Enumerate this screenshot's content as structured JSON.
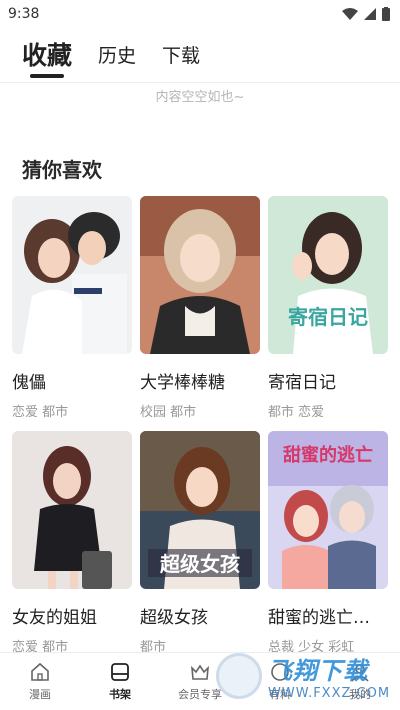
{
  "status": {
    "time": "9:38"
  },
  "tabs": [
    {
      "label": "收藏",
      "active": true
    },
    {
      "label": "历史",
      "active": false
    },
    {
      "label": "下载",
      "active": false
    }
  ],
  "empty_text": "内容空空如也~",
  "section_title": "猜你喜欢",
  "comics": [
    {
      "title": "傀儡",
      "tags": "恋爱 都市"
    },
    {
      "title": "大学棒棒糖",
      "tags": "校园 都市"
    },
    {
      "title": "寄宿日记",
      "tags": "都市 恋爱",
      "cover_text": "寄宿日记"
    },
    {
      "title": "女友的姐姐",
      "tags": "恋爱 都市"
    },
    {
      "title": "超级女孩",
      "tags": "都市",
      "cover_text": "超级女孩"
    },
    {
      "title": "甜蜜的逃亡…",
      "tags": "总裁 少女 彩虹",
      "cover_text": "甜蜜的逃亡"
    }
  ],
  "bottom_nav": [
    {
      "label": "漫画",
      "icon": "home-icon",
      "active": false
    },
    {
      "label": "书架",
      "icon": "bookshelf-icon",
      "active": true
    },
    {
      "label": "会员专享",
      "icon": "crown-icon",
      "active": false
    },
    {
      "label": "有料",
      "icon": "discover-icon",
      "active": false
    },
    {
      "label": "我的",
      "icon": "user-icon",
      "active": false
    }
  ],
  "watermark": {
    "cn": "飞翔下载",
    "url": "WWW.FXXZ.COM"
  },
  "colors": {
    "accent": "#222222",
    "muted": "#999999",
    "watermark": "#2f8fd8"
  }
}
